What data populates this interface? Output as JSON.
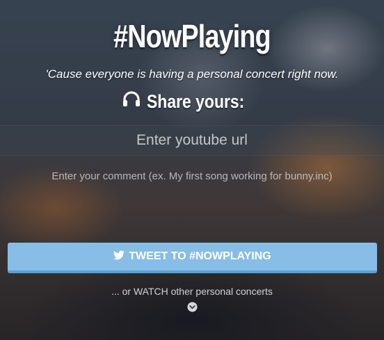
{
  "header": {
    "title": "#NowPlaying",
    "subtitle": "'Cause everyone is having a personal concert right now.",
    "share_label": "Share yours:"
  },
  "form": {
    "url_placeholder": "Enter youtube url",
    "url_value": "",
    "comment_placeholder": "Enter your comment (ex. My first song working for bunny.inc)",
    "comment_value": ""
  },
  "actions": {
    "tweet_label": "TWEET TO #NOWPLAYING",
    "watch_label": "... or WATCH other personal concerts"
  },
  "icons": {
    "share": "headphones-icon",
    "tweet": "twitter-bird-icon",
    "scroll": "chevron-circle-down-icon"
  },
  "colors": {
    "button_bg": "#87bde6",
    "button_border": "#5e9ed0",
    "text": "#ffffff"
  }
}
